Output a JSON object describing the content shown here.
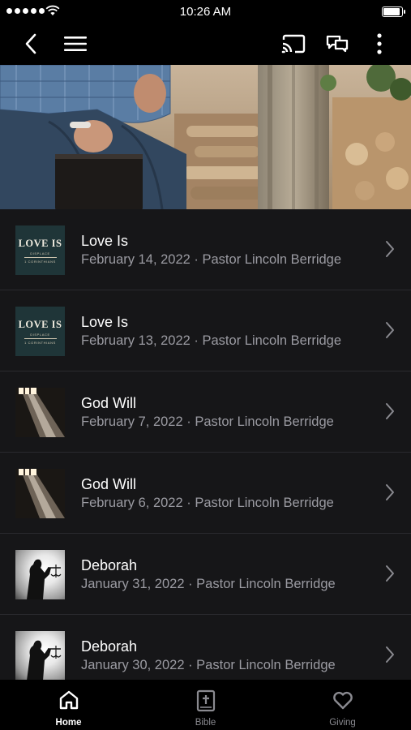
{
  "status_bar": {
    "time": "10:26 AM"
  },
  "icons": {
    "back": "chevron-left-icon",
    "menu": "hamburger-menu-icon",
    "cast": "cast-icon",
    "chat": "chat-bubbles-icon",
    "more": "more-vertical-icon"
  },
  "sermons": [
    {
      "title": "Love Is",
      "meta": "February 14, 2022 · Pastor Lincoln Berridge",
      "thumb": "love"
    },
    {
      "title": "Love Is",
      "meta": "February 13, 2022 · Pastor Lincoln Berridge",
      "thumb": "love"
    },
    {
      "title": "God Will",
      "meta": "February 7, 2022 · Pastor Lincoln Berridge",
      "thumb": "god"
    },
    {
      "title": "God Will",
      "meta": "February 6, 2022 · Pastor Lincoln Berridge",
      "thumb": "god"
    },
    {
      "title": "Deborah",
      "meta": "January 31, 2022 · Pastor Lincoln Berridge",
      "thumb": "deb"
    },
    {
      "title": "Deborah",
      "meta": "January 30, 2022 · Pastor Lincoln Berridge",
      "thumb": "deb"
    }
  ],
  "thumb_art": {
    "love": {
      "title": "LOVE IS",
      "sub": "DISPLACE",
      "sub2": "1 CORINTHIANS"
    }
  },
  "tabs": [
    {
      "label": "Home",
      "icon": "home-icon",
      "active": true
    },
    {
      "label": "Bible",
      "icon": "bible-icon",
      "active": false
    },
    {
      "label": "Giving",
      "icon": "heart-icon",
      "active": false
    }
  ],
  "colors": {
    "background": "#161618",
    "bar": "#000000",
    "subtext": "#9b9ba2"
  }
}
